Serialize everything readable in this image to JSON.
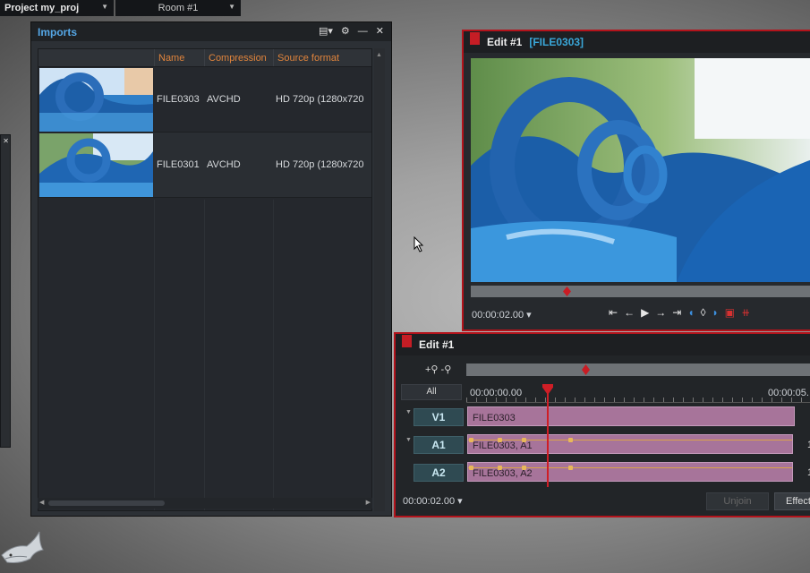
{
  "topbar": {
    "project_label": "Project my_proj",
    "room_label": "Room #1"
  },
  "imports": {
    "title": "Imports",
    "columns": [
      "Name",
      "Compression",
      "Source format"
    ],
    "rows": [
      {
        "name": "FILE0303",
        "compression": "AVCHD",
        "source_format": "HD 720p (1280x720"
      },
      {
        "name": "FILE0301",
        "compression": "AVCHD",
        "source_format": "HD 720p (1280x720"
      }
    ]
  },
  "viewer": {
    "title": "Edit #1",
    "subtitle": "[FILE0303]",
    "timecode": "00:00:02.00"
  },
  "timeline": {
    "title": "Edit #1",
    "all_label": "All",
    "ruler_start": "00:00:00.00",
    "ruler_next": "00:00:05.",
    "tracks": [
      {
        "label": "V1",
        "clip": "FILE0303"
      },
      {
        "label": "A1",
        "clip": "FILE0303, A1"
      },
      {
        "label": "A2",
        "clip": "FILE0303, A2"
      }
    ],
    "timecode": "00:00:02.00",
    "unjoin_label": "Unjoin",
    "effects_label": "Effects",
    "cut_marker": "1"
  },
  "colors": {
    "accent_red": "#b3131b",
    "title_blue": "#55a7e6",
    "column_orange": "#e0843c",
    "clip_pink": "#a7749a"
  }
}
